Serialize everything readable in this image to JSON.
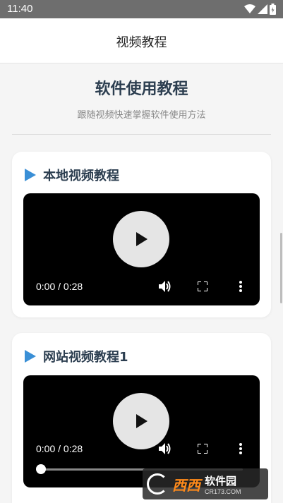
{
  "status_bar": {
    "time": "11:40"
  },
  "app_bar": {
    "title": "视频教程"
  },
  "page": {
    "heading": "软件使用教程",
    "subtitle": "跟随视频快速掌握软件使用方法"
  },
  "videos": [
    {
      "title": "本地视频教程",
      "time": "0:00 / 0:28"
    },
    {
      "title": "网站视频教程1",
      "time": "0:00 / 0:28"
    }
  ],
  "watermark": {
    "name": "西西",
    "brand": "软件园",
    "domain": "CR173.COM"
  },
  "colors": {
    "accent": "#3a8fd6",
    "heading": "#2c3e50"
  }
}
